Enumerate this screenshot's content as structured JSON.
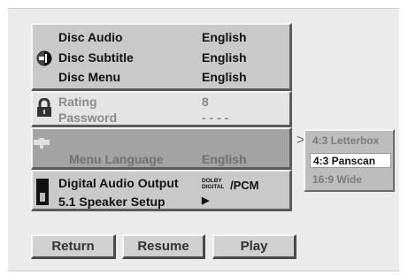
{
  "language_panel": {
    "disc_audio_label": "Disc Audio",
    "disc_audio_value": "English",
    "disc_subtitle_label": "Disc Subtitle",
    "disc_subtitle_value": "English",
    "disc_menu_label": "Disc Menu",
    "disc_menu_value": "English"
  },
  "lock_panel": {
    "rating_label": "Rating",
    "rating_value": "8",
    "password_label": "Password",
    "password_value": "- - - -"
  },
  "display_panel": {
    "menu_language_label": "Menu Language",
    "menu_language_value": "English"
  },
  "audio_panel": {
    "digital_audio_label": "Digital Audio Output",
    "dolby_line1": "DOLBY",
    "dolby_line2": "DIGITAL",
    "pcm_label": "/PCM",
    "speaker_setup_label": "5.1 Speaker Setup",
    "speaker_arrow": "▶"
  },
  "aspect_popup": {
    "options": [
      "4:3 Letterbox",
      "4:3 Panscan",
      "16:9 Wide"
    ],
    "selected": "4:3 Panscan"
  },
  "buttons": {
    "return_label": "Return",
    "resume_label": "Resume",
    "play_label": "Play"
  },
  "icons": {
    "language": "subtitle-face-icon",
    "lock": "padlock-icon",
    "display": "tv-display-icon",
    "audio": "speaker-icon"
  }
}
